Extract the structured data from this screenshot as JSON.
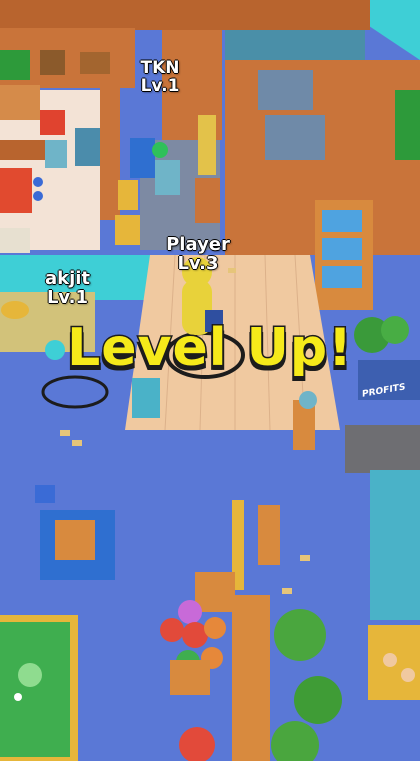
{
  "players": [
    {
      "name": "TKN",
      "level": "Lv.1"
    },
    {
      "name": "Player",
      "level": "Lv.3"
    },
    {
      "name": "akjit",
      "level": "Lv.1"
    }
  ],
  "banner": {
    "text": "Level Up!"
  },
  "sign": {
    "text": "PROFITS"
  },
  "colors": {
    "floor": "#5a78d6",
    "wall": "#c9743a",
    "wood_floor": "#f0c9a0",
    "banner": "#f6ea1a",
    "teal": "#3ecfd6",
    "pool_table": "#3fae4f"
  }
}
